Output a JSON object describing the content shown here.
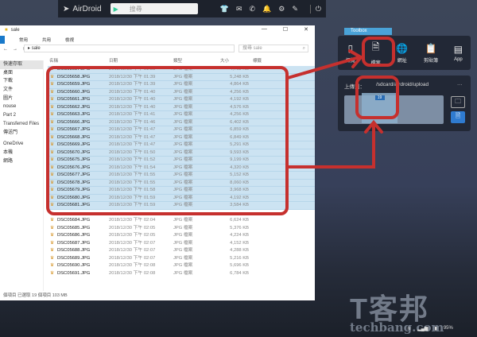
{
  "airdroid": {
    "logo": "AirDroid",
    "search_placeholder": "搜尋",
    "icons": [
      "tshirt-icon",
      "mail-icon",
      "phone-icon",
      "bell-icon",
      "gear-icon",
      "pen-icon",
      "power-icon"
    ]
  },
  "explorer": {
    "title": "sale",
    "ribbon": [
      "常用",
      "共用",
      "檢視"
    ],
    "address": "sale",
    "search_placeholder": "搜尋 sale",
    "columns": [
      "名稱",
      "日期",
      "類型",
      "大小",
      "標籤"
    ],
    "sidebar": [
      "快速存取",
      "桌面",
      "下載",
      "文件",
      "圖片",
      "nouse",
      "Part 2",
      "Transferred Files",
      "傳送門",
      "OneDrive",
      "本機",
      "網路"
    ],
    "rows": [
      [
        "DSC05657.JPG",
        "2018/12/30 下午 01:38",
        "JPG 檔案",
        "4,768 KB",
        true
      ],
      [
        "DSC05658.JPG",
        "2018/12/30 下午 01:39",
        "JPG 檔案",
        "5,248 KB",
        true
      ],
      [
        "DSC05659.JPG",
        "2018/12/30 下午 01:39",
        "JPG 檔案",
        "4,864 KB",
        true
      ],
      [
        "DSC05660.JPG",
        "2018/12/30 下午 01:40",
        "JPG 檔案",
        "4,256 KB",
        true
      ],
      [
        "DSC05661.JPG",
        "2018/12/30 下午 01:40",
        "JPG 檔案",
        "4,192 KB",
        true
      ],
      [
        "DSC05662.JPG",
        "2018/12/30 下午 01:40",
        "JPG 檔案",
        "4,576 KB",
        true
      ],
      [
        "DSC05663.JPG",
        "2018/12/30 下午 01:41",
        "JPG 檔案",
        "4,256 KB",
        true
      ],
      [
        "DSC05666.JPG",
        "2018/12/30 下午 01:46",
        "JPG 檔案",
        "6,402 KB",
        true
      ],
      [
        "DSC05667.JPG",
        "2018/12/30 下午 01:47",
        "JPG 檔案",
        "6,859 KB",
        true
      ],
      [
        "DSC05668.JPG",
        "2018/12/30 下午 01:47",
        "JPG 檔案",
        "6,849 KB",
        true
      ],
      [
        "DSC05669.JPG",
        "2018/12/30 下午 01:47",
        "JPG 檔案",
        "5,291 KB",
        true
      ],
      [
        "DSC05670.JPG",
        "2018/12/30 下午 01:50",
        "JPG 檔案",
        "9,593 KB",
        true
      ],
      [
        "DSC05675.JPG",
        "2018/12/30 下午 01:52",
        "JPG 檔案",
        "9,199 KB",
        true
      ],
      [
        "DSC05676.JPG",
        "2018/12/30 下午 01:54",
        "JPG 檔案",
        "4,320 KB",
        true
      ],
      [
        "DSC05677.JPG",
        "2018/12/30 下午 01:55",
        "JPG 檔案",
        "5,152 KB",
        true
      ],
      [
        "DSC05678.JPG",
        "2018/12/30 下午 01:55",
        "JPG 檔案",
        "8,060 KB",
        true
      ],
      [
        "DSC05679.JPG",
        "2018/12/30 下午 01:58",
        "JPG 檔案",
        "3,968 KB",
        true
      ],
      [
        "DSC05680.JPG",
        "2018/12/30 下午 01:59",
        "JPG 檔案",
        "4,192 KB",
        true
      ],
      [
        "DSC05681.JPG",
        "2018/12/30 下午 01:59",
        "JPG 檔案",
        "3,584 KB",
        true
      ],
      [
        "",
        "",
        "",
        "",
        false
      ],
      [
        "DSC05684.JPG",
        "2018/12/30 下午 02:04",
        "JPG 檔案",
        "6,624 KB",
        false
      ],
      [
        "DSC05685.JPG",
        "2018/12/30 下午 02:05",
        "JPG 檔案",
        "5,376 KB",
        false
      ],
      [
        "DSC05686.JPG",
        "2018/12/30 下午 02:05",
        "JPG 檔案",
        "4,224 KB",
        false
      ],
      [
        "DSC05687.JPG",
        "2018/12/30 下午 02:07",
        "JPG 檔案",
        "4,152 KB",
        false
      ],
      [
        "DSC05688.JPG",
        "2018/12/30 下午 02:07",
        "JPG 檔案",
        "4,288 KB",
        false
      ],
      [
        "DSC05689.JPG",
        "2018/12/30 下午 02:07",
        "JPG 檔案",
        "5,216 KB",
        false
      ],
      [
        "DSC05690.JPG",
        "2018/12/30 下午 02:08",
        "JPG 檔案",
        "5,696 KB",
        false
      ],
      [
        "DSC05691.JPG",
        "2018/12/30 下午 02:08",
        "JPG 檔案",
        "6,784 KB",
        false
      ]
    ],
    "status": "個項目   已選取 19 個項目  103 MB"
  },
  "toolbox": {
    "tab": "Toolbox",
    "items": [
      "概覽",
      "檔案",
      "網址",
      "剪貼簿",
      "App"
    ]
  },
  "upload": {
    "label": "上傳到：",
    "path": "/sdcard/airdroid/upload",
    "more": "···",
    "count": "19"
  },
  "watermark": {
    "cn": "T客邦",
    "en": "techbang.com"
  },
  "taskbar": {
    "battery": "95%"
  },
  "colors": {
    "annotation": "#c6302e",
    "selection": "#cce3f2",
    "accent": "#4aa3d8"
  }
}
